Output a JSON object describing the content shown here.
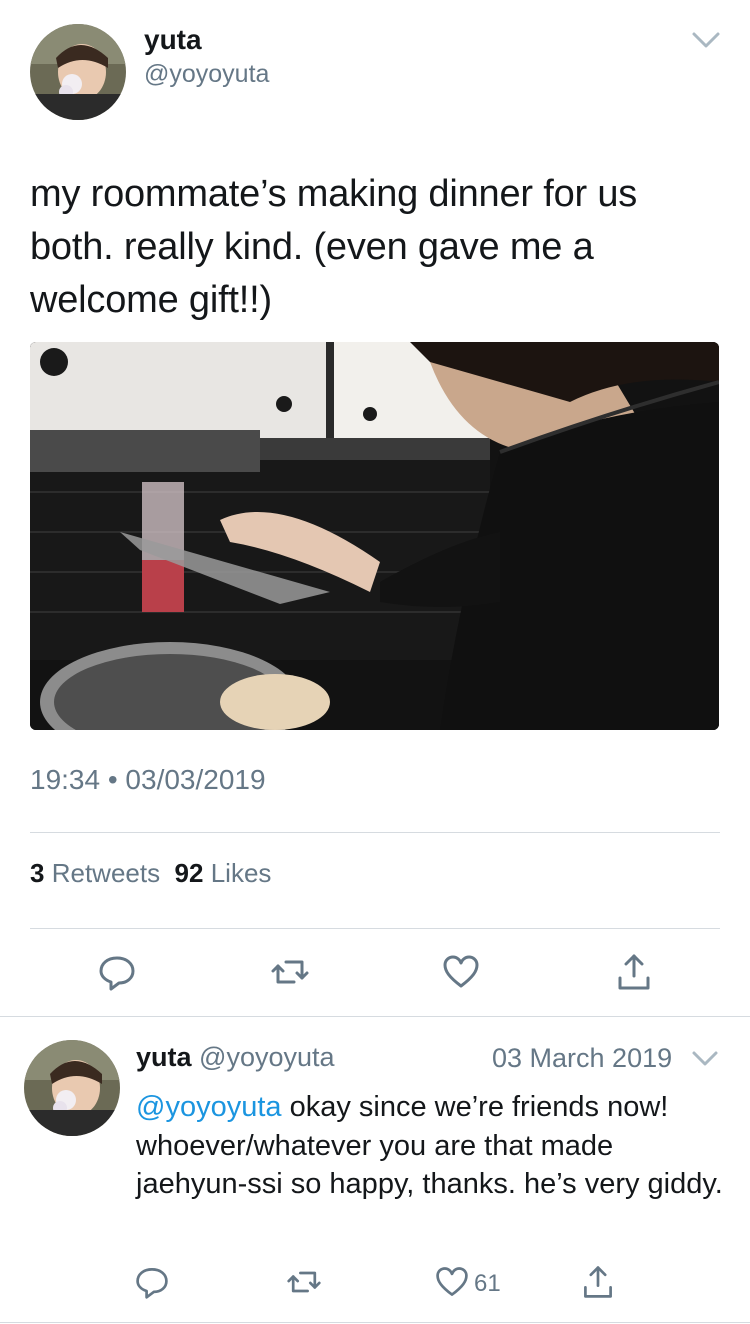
{
  "tweet": {
    "author_name": "yuta",
    "author_handle": "@yoyoyuta",
    "text": "my roommate’s making dinner for us both. really kind. (even gave me a welcome gift!!)",
    "timestamp": "19:34 • 03/03/2019",
    "retweets_count": "3",
    "retweets_label": "Retweets",
    "likes_count": "92",
    "likes_label": "Likes",
    "actions": [
      "reply-icon",
      "retweet-icon",
      "like-icon",
      "share-icon"
    ]
  },
  "reply": {
    "author_name": "yuta",
    "author_handle": "@yoyoyuta",
    "date": "03 March 2019",
    "mention": "@yoyoyuta",
    "text": " okay since we’re friends now! whoever/whatever you are that made jaehyun-ssi so happy, thanks. he’s very giddy.",
    "like_count": "61",
    "actions": [
      "reply-icon",
      "retweet-icon",
      "like-icon",
      "share-icon"
    ]
  },
  "colors": {
    "text": "#14171a",
    "secondary": "#657786",
    "link": "#1b95e0",
    "divider": "#d6dbe0"
  }
}
